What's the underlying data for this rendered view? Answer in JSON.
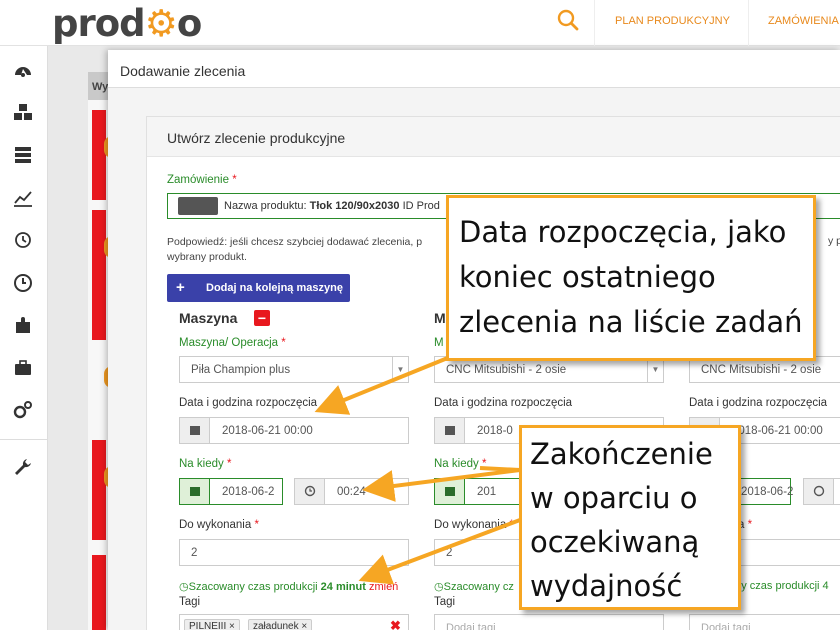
{
  "brand": {
    "logo_text": "prod",
    "logo_end": "o",
    "accent": "#f19a21"
  },
  "topnav": {
    "items": [
      "PLAN PRODUKCYJNY",
      "ZAMÓWIENIA"
    ]
  },
  "background_list": {
    "header": "Wy"
  },
  "modal": {
    "title": "Dodawanie zlecenia",
    "panel_title": "Utwórz zlecenie produkcyjne",
    "order": {
      "label": "Zamówienie",
      "product_prefix": "Nazwa produktu: ",
      "product_name": "Tłok 120/90x2030",
      "product_suffix": " ID Prod"
    },
    "hint": "Podpowiedź: jeśli chcesz szybciej dodawać zlecenia, p",
    "hint_line2": "wybrany produkt.",
    "hint_right": "y pro",
    "add_machine_button": "Dodaj na kolejną maszynę",
    "labels": {
      "machine_op": "Maszyna/ Operacja",
      "start": "Data i godzina rozpoczęcia",
      "deadline": "Na kiedy",
      "todo": "Do wykonania",
      "todo_partial": "o wykonania",
      "todo_partial3": "nia",
      "tags": "Tagi",
      "est_prefix": "Szacowany czas produkcji ",
      "est_value": "24 minut",
      "est_change": " zmień",
      "est_partial2": "Szacowany cz",
      "est_partial3": "any czas produkcji 4"
    },
    "columns": [
      {
        "title": "Maszyna",
        "machine": "Piła Champion plus",
        "start": "2018-06-21 00:00",
        "deadline_date": "2018-06-2",
        "deadline_time": "00:24",
        "qty": "2",
        "tags": [
          "PILNEIII",
          "załadunek"
        ]
      },
      {
        "title": "M",
        "machine_prefix": "M",
        "machine": "CNC Mitsubishi - 2 osie",
        "start": "2018-0",
        "deadline_date": "201",
        "qty": "2",
        "tags_placeholder": "Dodaj tagi"
      },
      {
        "machine": "CNC Mitsubishi - 2 osie",
        "start": "2018-06-21 00:00",
        "deadline_date": "2018-06-2",
        "tags_placeholder": "Dodaj tagi"
      }
    ]
  },
  "callouts": {
    "start": [
      "Data rozpoczęcia, jako",
      "koniec ostatniego",
      "zlecenia na liście zadań"
    ],
    "end": [
      "Zakończenie",
      "w oparciu o",
      "oczekiwaną",
      "wydajność"
    ]
  }
}
